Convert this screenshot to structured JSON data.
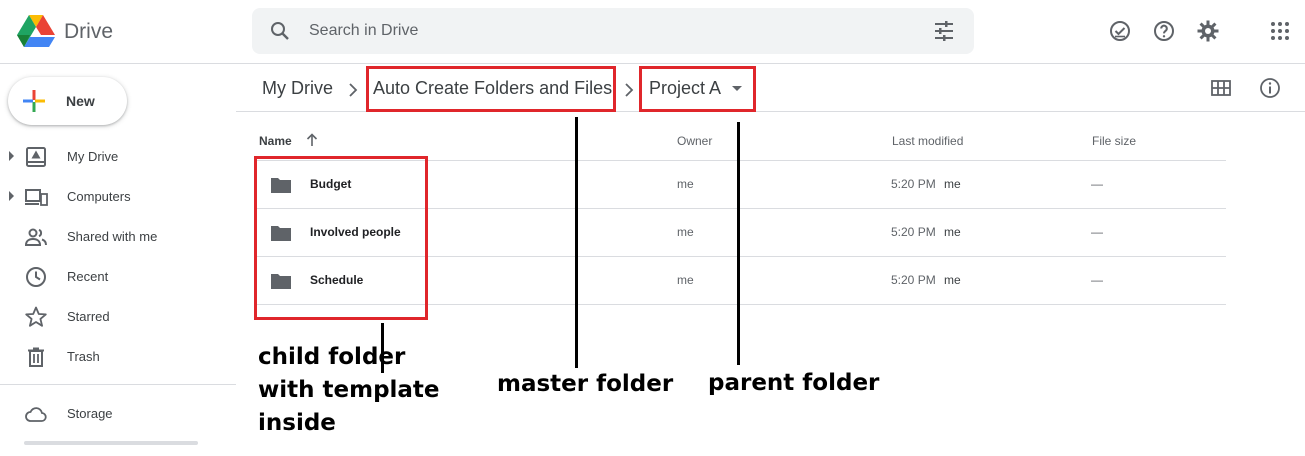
{
  "app": {
    "name": "Drive"
  },
  "search": {
    "placeholder": "Search in Drive"
  },
  "sidebar": {
    "new_label": "New",
    "items": [
      {
        "label": "My Drive",
        "icon": "my-drive-icon",
        "expandable": true
      },
      {
        "label": "Computers",
        "icon": "computers-icon",
        "expandable": true
      },
      {
        "label": "Shared with me",
        "icon": "shared-icon",
        "expandable": false
      },
      {
        "label": "Recent",
        "icon": "clock-icon",
        "expandable": false
      },
      {
        "label": "Starred",
        "icon": "star-icon",
        "expandable": false
      },
      {
        "label": "Trash",
        "icon": "trash-icon",
        "expandable": false
      }
    ],
    "storage_label": "Storage"
  },
  "breadcrumb": {
    "items": [
      "My Drive",
      "Auto Create Folders and Files",
      "Project A"
    ]
  },
  "table": {
    "columns": {
      "name": "Name",
      "owner": "Owner",
      "modified": "Last modified",
      "size": "File size"
    },
    "rows": [
      {
        "name": "Budget",
        "owner": "me",
        "modified": "5:20 PM",
        "modified_by": "me",
        "size": "—"
      },
      {
        "name": "Involved people",
        "owner": "me",
        "modified": "5:20 PM",
        "modified_by": "me",
        "size": "—"
      },
      {
        "name": "Schedule",
        "owner": "me",
        "modified": "5:20 PM",
        "modified_by": "me",
        "size": "—"
      }
    ]
  },
  "annotations": {
    "child_lines": [
      "child folder",
      "with template",
      "inside"
    ],
    "master": "master folder",
    "parent": "parent folder"
  },
  "colors": {
    "annotation_red": "#e0262b",
    "accent_blue": "#1a73e8"
  }
}
